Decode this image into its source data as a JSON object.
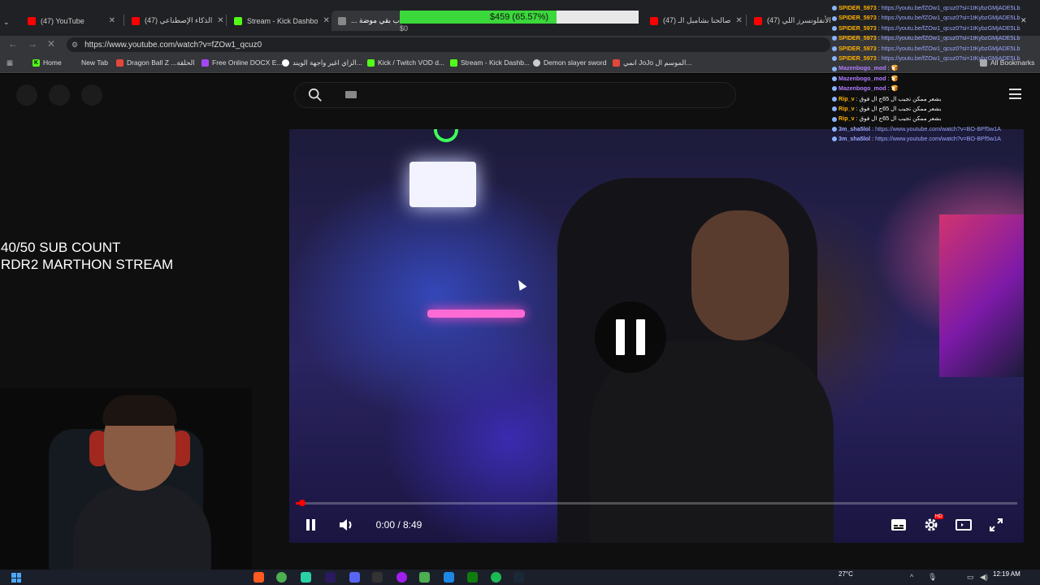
{
  "browser": {
    "tabs": [
      {
        "title": "(47) YouTube",
        "color": "#ff0000"
      },
      {
        "title": "(47) الذكاء الإصطناعي",
        "color": "#ff0000"
      },
      {
        "title": "Stream - Kick Dashbo",
        "color": "#53fc18"
      },
      {
        "title": "... ب بقي موضة",
        "color": "#888888"
      },
      {
        "title": "(47) صالحنا بشامبل الـ",
        "color": "#ff0000"
      },
      {
        "title": "(47) الأنفلونسرز اللي",
        "color": "#ff0000"
      }
    ],
    "url": "https://www.youtube.com/watch?v=fZOw1_qcuz0",
    "bookmarks": [
      {
        "label": "Home",
        "icon": "kick-icon",
        "color": "#53fc18"
      },
      {
        "label": "New Tab",
        "icon": "",
        "color": ""
      },
      {
        "label": "Dragon Ball Z ...الحلقة",
        "icon": "anime-icon",
        "color": "#e5473b"
      },
      {
        "label": "Free Online DOCX E...",
        "icon": "docx-icon",
        "color": "#a347f5"
      },
      {
        "label": "الزاي اغير واجهة الويند...",
        "icon": "google-icon",
        "color": "#ffffff"
      },
      {
        "label": "Kick / Twitch VOD d...",
        "icon": "kick-icon",
        "color": "#53fc18"
      },
      {
        "label": "Stream - Kick Dashb...",
        "icon": "kick-icon",
        "color": "#53fc18"
      },
      {
        "label": "Demon slayer sword",
        "icon": "globe-icon",
        "color": "#cccccc"
      },
      {
        "label": "انمي JoJo الموسم ال...",
        "icon": "anime-icon",
        "color": "#e5473b"
      }
    ],
    "all_bookmarks": "All Bookmarks"
  },
  "donation_goal": {
    "text": "$459 (65.57%)",
    "progress": 0.6557,
    "start_label": "$0"
  },
  "overlay_text": {
    "line1": "40/50 SUB COUNT",
    "line2": "RDR2 MARTHON STREAM"
  },
  "player": {
    "time": "0:00 / 8:49",
    "progress": 0.004,
    "hd_badge": "HD"
  },
  "chat": [
    {
      "user": "SPIDER_5973",
      "msg": "https://youtu.be/fZOw1_qcuz0?si=1tKybzGMjADE5Lb",
      "user_color": "#ffb000"
    },
    {
      "user": "SPIDER_5973",
      "msg": "https://youtu.be/fZOw1_qcuz0?si=1tKybzGMjADE5Lb",
      "user_color": "#ffb000"
    },
    {
      "user": "SPIDER_5973",
      "msg": "https://youtu.be/fZOw1_qcuz0?si=1tKybzGMjADE5Lb",
      "user_color": "#ffb000"
    },
    {
      "user": "SPIDER_5973",
      "msg": "https://youtu.be/fZOw1_qcuz0?si=1tKybzGMjADE5Lb",
      "user_color": "#ffb000"
    },
    {
      "user": "SPIDER_5973",
      "msg": "https://youtu.be/fZOw1_qcuz0?si=1tKybzGMjADE5Lb",
      "user_color": "#ffb000"
    },
    {
      "user": "SPIDER_5973",
      "msg": "https://youtu.be/fZOw1_qcuz0?si=1tKybzGMjADE5Lb",
      "user_color": "#ffb000"
    },
    {
      "user": "Mazenbogo_mod",
      "msg": "🍞",
      "user_color": "#b07cff"
    },
    {
      "user": "Mazenbogo_mod",
      "msg": "🍞",
      "user_color": "#b07cff"
    },
    {
      "user": "Mazenbogo_mod",
      "msg": "🍞",
      "user_color": "#b07cff"
    },
    {
      "user": "Rip_v",
      "msg": "بشعر ممكن تجيب ال 65ج ال فوق",
      "user_color": "#ffb000"
    },
    {
      "user": "Rip_v",
      "msg": "بشعر ممكن تجيب ال 65ج ال فوق",
      "user_color": "#ffb000"
    },
    {
      "user": "Rip_v",
      "msg": "بشعر ممكن تجيب ال 65ج ال فوق",
      "user_color": "#ffb000"
    },
    {
      "user": "3m_sha5lol",
      "msg": "https://www.youtube.com/watch?v=BO-BPf5w1A",
      "user_color": "#9aa6ff"
    },
    {
      "user": "3m_sha5lol",
      "msg": "https://www.youtube.com/watch?v=BO-BPf5w1A",
      "user_color": "#9aa6ff"
    }
  ],
  "taskbar": {
    "temperature": "27°C",
    "time": "12:19 AM"
  },
  "colors": {
    "youtube_red": "#ff0000",
    "kick_green": "#53fc18",
    "goal_fill": "#3bd83b"
  }
}
